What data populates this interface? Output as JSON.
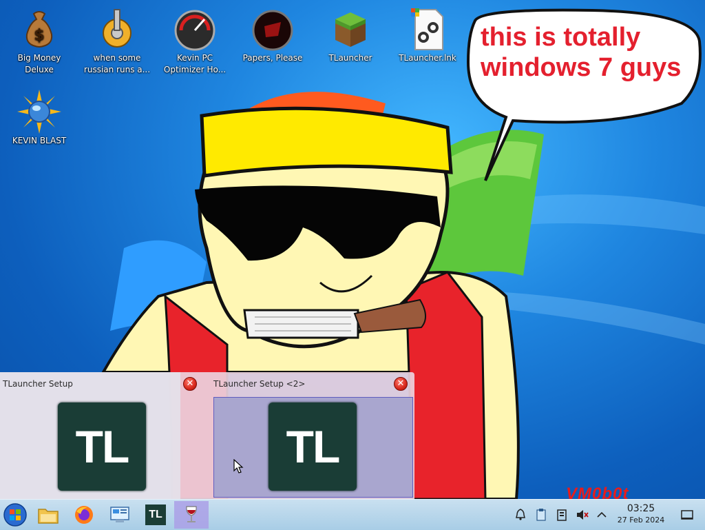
{
  "desktop": {
    "icons": [
      {
        "label_line1": "Big Money",
        "label_line2": "Deluxe",
        "icon": "money-bag-icon"
      },
      {
        "label_line1": "when some",
        "label_line2": "russian runs a...",
        "icon": "gear-icon"
      },
      {
        "label_line1": "Kevin PC",
        "label_line2": "Optimizer Ho...",
        "icon": "speedometer-icon"
      },
      {
        "label_line1": "Papers, Please",
        "label_line2": "",
        "icon": "papers-please-icon"
      },
      {
        "label_line1": "TLauncher",
        "label_line2": "",
        "icon": "grass-block-icon"
      },
      {
        "label_line1": "TLauncher.lnk",
        "label_line2": "",
        "icon": "shortcut-link-icon"
      },
      {
        "label_line1": "KEVIN BLAST",
        "label_line2": "",
        "icon": "globe-sun-icon"
      }
    ]
  },
  "meme": {
    "speech_bubble": "this is totally windows 7 guys",
    "signature": "VM0b0t"
  },
  "previews": [
    {
      "title": "TLauncher Setup",
      "logo": "TL"
    },
    {
      "title": "TLauncher Setup <2>",
      "logo": "TL"
    }
  ],
  "taskbar": {
    "start_icon": "windows-orb-icon",
    "items": [
      "file-manager-icon",
      "firefox-icon",
      "control-panel-icon",
      "tlauncher-icon",
      "wine-glass-icon"
    ],
    "tlauncher_label": "TL",
    "clock_time": "03:25",
    "clock_date": "27 Feb 2024"
  }
}
